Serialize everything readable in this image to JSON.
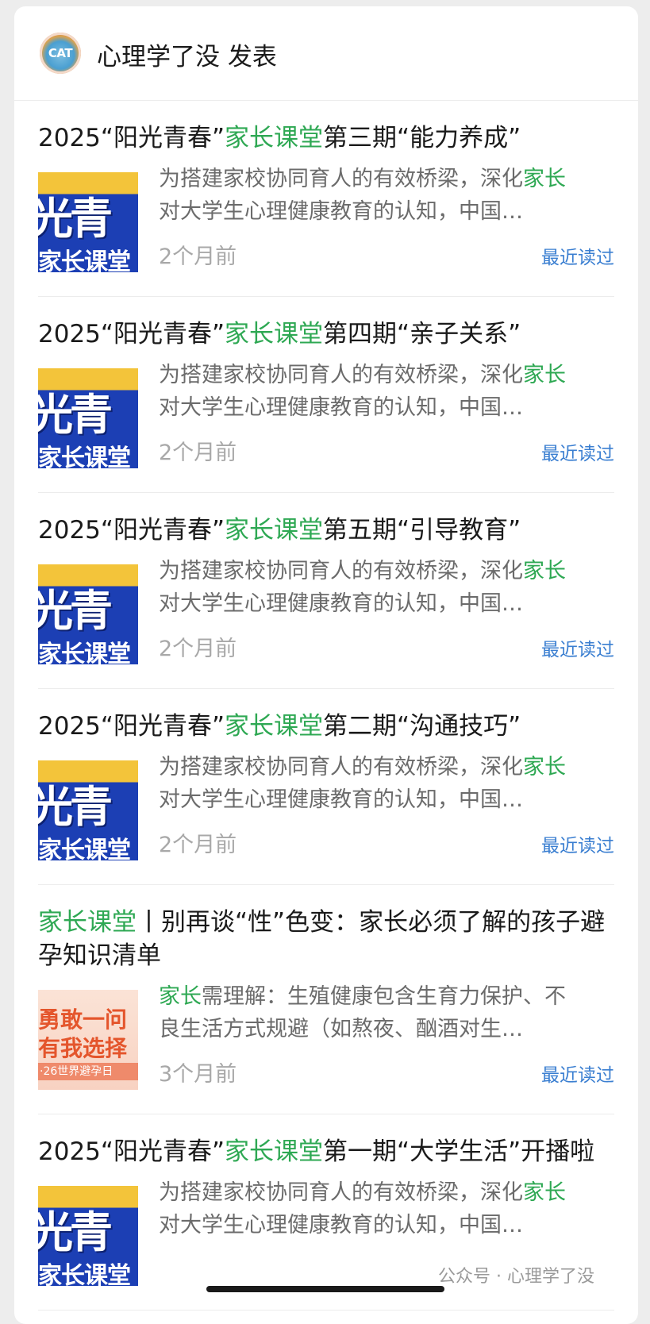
{
  "account": {
    "avatar_text": "CAT",
    "name": "心理学了没 发表"
  },
  "articles": [
    {
      "title_prefix": "2025“阳光青春”",
      "title_highlight": "家长课堂",
      "title_suffix": "第三期“能力养成”",
      "summary_prefix": "为搭建家校协同育人的有效桥梁，深化",
      "summary_highlight": "家长",
      "summary_suffix": "对大学生心理健康教育的认知，中国…",
      "thumb_line1": "光青",
      "thumb_line2": "家长课堂",
      "time": "2个月前",
      "status": "最近读过"
    },
    {
      "title_prefix": "2025“阳光青春”",
      "title_highlight": "家长课堂",
      "title_suffix": "第四期“亲子关系”",
      "summary_prefix": "为搭建家校协同育人的有效桥梁，深化",
      "summary_highlight": "家长",
      "summary_suffix": "对大学生心理健康教育的认知，中国…",
      "thumb_line1": "光青",
      "thumb_line2": "家长课堂",
      "time": "2个月前",
      "status": "最近读过"
    },
    {
      "title_prefix": "2025“阳光青春”",
      "title_highlight": "家长课堂",
      "title_suffix": "第五期“引导教育”",
      "summary_prefix": "为搭建家校协同育人的有效桥梁，深化",
      "summary_highlight": "家长",
      "summary_suffix": "对大学生心理健康教育的认知，中国…",
      "thumb_line1": "光青",
      "thumb_line2": "家长课堂",
      "time": "2个月前",
      "status": "最近读过"
    },
    {
      "title_prefix": "2025“阳光青春”",
      "title_highlight": "家长课堂",
      "title_suffix": "第二期“沟通技巧”",
      "summary_prefix": "为搭建家校协同育人的有效桥梁，深化",
      "summary_highlight": "家长",
      "summary_suffix": "对大学生心理健康教育的认知，中国…",
      "thumb_line1": "光青",
      "thumb_line2": "家长课堂",
      "time": "2个月前",
      "status": "最近读过"
    },
    {
      "title_prefix": "",
      "title_highlight": "家长课堂",
      "title_suffix": "丨别再谈“性”色变：家长必须了解的孩子避孕知识清单",
      "summary_prefix": "",
      "summary_highlight": "家长",
      "summary_suffix": "需理解：生殖健康包含生育力保护、不良生活方式规避（如熬夜、酗酒对生…",
      "thumb_line1": "勇敢一问",
      "thumb_line2": "有我选择",
      "thumb_line3": "·26世界避孕日",
      "time": "3个月前",
      "status": "最近读过"
    },
    {
      "title_prefix": "2025“阳光青春”",
      "title_highlight": "家长课堂",
      "title_suffix": "第一期“大学生活”开播啦",
      "summary_prefix": "为搭建家校协同育人的有效桥梁，深化",
      "summary_highlight": "家长",
      "summary_suffix": "对大学生心理健康教育的认知，中国…",
      "thumb_line1": "光青",
      "thumb_line2": "家长课堂",
      "time": "",
      "status": ""
    }
  ],
  "watermark": "公众号 · 心理学了没"
}
